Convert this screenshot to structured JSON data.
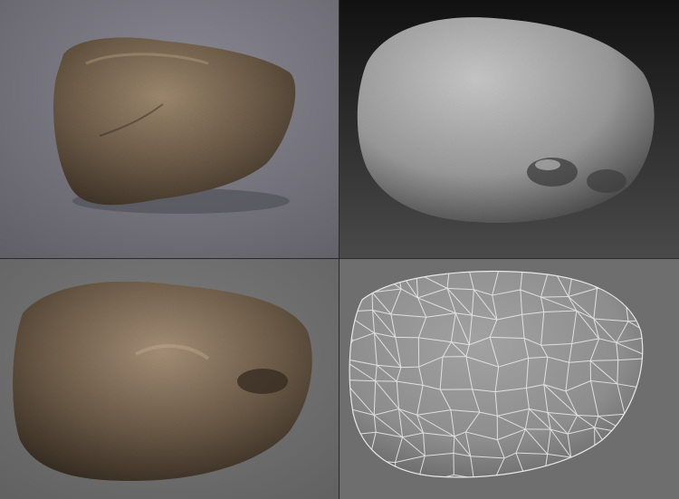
{
  "figure": {
    "panels": [
      {
        "id": "textured-render",
        "background": "#75747c"
      },
      {
        "id": "sculpt-render",
        "background": "#1a1a1a"
      },
      {
        "id": "textured-lit-render",
        "background": "#6f6f6f"
      },
      {
        "id": "wireframe-render",
        "background": "#6e6e6e"
      }
    ],
    "colors": {
      "stone_base": "#6b5a47",
      "stone_dark": "#3a2f24",
      "stone_light": "#a08a70",
      "clay": "#9a9a9a",
      "clay_dark": "#2f2f2f",
      "wire": "#e8e8e8",
      "mesh_surface": "#8d8d8d"
    }
  }
}
